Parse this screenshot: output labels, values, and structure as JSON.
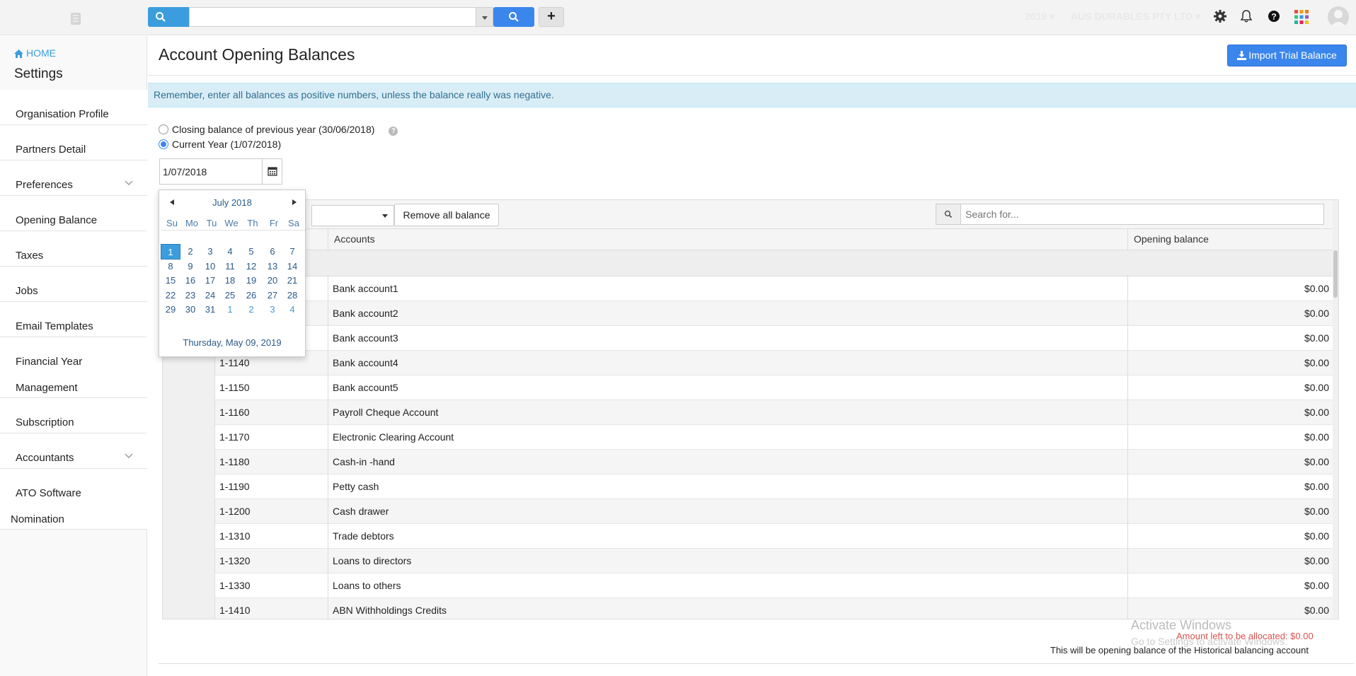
{
  "topbar": {
    "search_value": "",
    "year": "2019",
    "company": "AUS DURABLES PTY LTD",
    "icons": [
      "logo-icon",
      "search-icon",
      "gear-icon",
      "bell-icon",
      "question-icon",
      "apps-grid-icon",
      "avatar"
    ]
  },
  "sidebar": {
    "home_label": "HOME",
    "title": "Settings",
    "items": [
      {
        "label": "Organisation Profile"
      },
      {
        "label": "Partners Detail"
      },
      {
        "label": "Preferences",
        "expandable": true
      },
      {
        "label": "Opening Balance"
      },
      {
        "label": "Taxes"
      },
      {
        "label": "Jobs"
      },
      {
        "label": "Email Templates"
      },
      {
        "label": "Financial Year",
        "label2": "Management"
      },
      {
        "label": "Subscription"
      },
      {
        "label": "Accountants",
        "expandable": true
      },
      {
        "label": "ATO Software",
        "label2": "Nomination"
      }
    ]
  },
  "main": {
    "title": "Account Opening Balances",
    "import_button": "Import Trial Balance",
    "info": "Remember, enter all balances as positive numbers, unless the balance really was negative.",
    "radio_previous": "Closing balance of previous year (30/06/2018)",
    "radio_current": "Current Year (1/07/2018)",
    "selected_radio": "current",
    "date_value": "1/07/2018"
  },
  "grid": {
    "remove_button": "Remove all balance",
    "search_placeholder": "Search for...",
    "columns": {
      "accounts": "Accounts",
      "opening_balance": "Opening balance"
    },
    "rows": [
      {
        "code": "",
        "account": "Bank account1",
        "balance": "$0.00"
      },
      {
        "code": "",
        "account": "Bank account2",
        "balance": "$0.00"
      },
      {
        "code": "",
        "account": "Bank account3",
        "balance": "$0.00"
      },
      {
        "code": "1-1140",
        "account": "Bank account4",
        "balance": "$0.00"
      },
      {
        "code": "1-1150",
        "account": "Bank account5",
        "balance": "$0.00"
      },
      {
        "code": "1-1160",
        "account": "Payroll Cheque Account",
        "balance": "$0.00"
      },
      {
        "code": "1-1170",
        "account": "Electronic Clearing Account",
        "balance": "$0.00"
      },
      {
        "code": "1-1180",
        "account": "Cash-in -hand",
        "balance": "$0.00"
      },
      {
        "code": "1-1190",
        "account": "Petty cash",
        "balance": "$0.00"
      },
      {
        "code": "1-1200",
        "account": "Cash drawer",
        "balance": "$0.00"
      },
      {
        "code": "1-1310",
        "account": "Trade debtors",
        "balance": "$0.00"
      },
      {
        "code": "1-1320",
        "account": "Loans to directors",
        "balance": "$0.00"
      },
      {
        "code": "1-1330",
        "account": "Loans to others",
        "balance": "$0.00"
      },
      {
        "code": "1-1410",
        "account": "ABN Withholdings Credits",
        "balance": "$0.00"
      }
    ]
  },
  "footer": {
    "amount_left": "Amount left to be allocated: $0.00",
    "opening_note": "This will be opening balance of the Historical balancing account"
  },
  "watermark": {
    "line1": "Activate Windows",
    "line2": "Go to Settings to activate Windows."
  },
  "datepicker": {
    "month_label": "July 2018",
    "days_of_week": [
      "Su",
      "Mo",
      "Tu",
      "We",
      "Th",
      "Fr",
      "Sa"
    ],
    "weeks": [
      [
        {
          "d": "1",
          "sel": true
        },
        {
          "d": "2"
        },
        {
          "d": "3"
        },
        {
          "d": "4"
        },
        {
          "d": "5"
        },
        {
          "d": "6"
        },
        {
          "d": "7"
        }
      ],
      [
        {
          "d": "8"
        },
        {
          "d": "9"
        },
        {
          "d": "10"
        },
        {
          "d": "11"
        },
        {
          "d": "12"
        },
        {
          "d": "13"
        },
        {
          "d": "14"
        }
      ],
      [
        {
          "d": "15"
        },
        {
          "d": "16"
        },
        {
          "d": "17"
        },
        {
          "d": "18"
        },
        {
          "d": "19"
        },
        {
          "d": "20"
        },
        {
          "d": "21"
        }
      ],
      [
        {
          "d": "22"
        },
        {
          "d": "23"
        },
        {
          "d": "24"
        },
        {
          "d": "25"
        },
        {
          "d": "26"
        },
        {
          "d": "27"
        },
        {
          "d": "28"
        }
      ],
      [
        {
          "d": "29"
        },
        {
          "d": "30"
        },
        {
          "d": "31"
        },
        {
          "d": "1",
          "other": true
        },
        {
          "d": "2",
          "other": true
        },
        {
          "d": "3",
          "other": true
        },
        {
          "d": "4",
          "other": true
        }
      ]
    ],
    "today_label": "Thursday, May 09, 2019"
  },
  "colors": {
    "primary": "#3b86ec",
    "info_bg": "#d9edf7",
    "info_text": "#31708f",
    "warning_text": "#d9534f"
  }
}
